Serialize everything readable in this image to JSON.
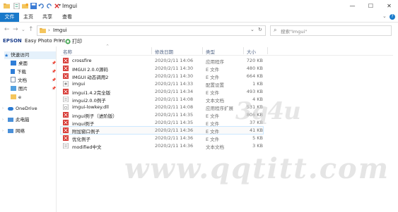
{
  "window": {
    "title": "Imgui",
    "minimize_glyph": "—",
    "maximize_glyph": "☐",
    "close_glyph": "✕",
    "help_glyph": "?"
  },
  "ribbon": {
    "tabs": [
      {
        "label": "文件",
        "active": true
      },
      {
        "label": "主页",
        "active": false
      },
      {
        "label": "共享",
        "active": false
      },
      {
        "label": "查看",
        "active": false
      }
    ]
  },
  "address": {
    "back_glyph": "←",
    "forward_glyph": "→",
    "recent_glyph": "⌄",
    "up_glyph": "↑",
    "separator": "›",
    "path": "Imgui",
    "dropdown_glyph": "⌄",
    "refresh_glyph": "↻",
    "search_placeholder": "搜索\"Imgui\"",
    "search_icon": "⌕"
  },
  "command_bar": {
    "brand": "EPSON",
    "product": "Easy Photo Print",
    "dropdown_glyph": "▾",
    "print_label": "打印"
  },
  "sidebar": {
    "items": [
      {
        "label": "快速访问",
        "icon": "star-icon",
        "pinned": false
      },
      {
        "label": "桌面",
        "icon": "desktop-icon",
        "pinned": true
      },
      {
        "label": "下载",
        "icon": "download-icon",
        "pinned": true
      },
      {
        "label": "文档",
        "icon": "document-icon",
        "pinned": true
      },
      {
        "label": "图片",
        "icon": "picture-icon",
        "pinned": true
      },
      {
        "label": "e",
        "icon": "folder-icon",
        "pinned": false
      },
      {
        "label": "OneDrive",
        "icon": "cloud-icon",
        "pinned": false
      },
      {
        "label": "此电脑",
        "icon": "computer-icon",
        "pinned": false
      },
      {
        "label": "网络",
        "icon": "network-icon",
        "pinned": false
      }
    ]
  },
  "columns": {
    "name": "名称",
    "date": "修改日期",
    "type": "类型",
    "size": "大小",
    "sort_glyph": "^"
  },
  "files": [
    {
      "name": "crossfire",
      "date": "2020/2/11 14:06",
      "type": "应用程序",
      "size": "720 KB",
      "icon": "exe-icon",
      "selected": false
    },
    {
      "name": "IMGUI 2.0.0源码",
      "date": "2020/2/11 14:30",
      "type": "E 文件",
      "size": "480 KB",
      "icon": "e-file-icon",
      "selected": false
    },
    {
      "name": "IMGUI 动态调用2",
      "date": "2020/2/11 14:30",
      "type": "E 文件",
      "size": "664 KB",
      "icon": "e-file-icon",
      "selected": false
    },
    {
      "name": "imgui",
      "date": "2020/2/11 14:33",
      "type": "配置设置",
      "size": "1 KB",
      "icon": "config-icon",
      "selected": false
    },
    {
      "name": "imgui1.4.2完全版",
      "date": "2020/2/11 14:34",
      "type": "E 文件",
      "size": "493 KB",
      "icon": "e-file-icon",
      "selected": false
    },
    {
      "name": "imgui2.0.0例子",
      "date": "2020/2/11 14:08",
      "type": "文本文档",
      "size": "4 KB",
      "icon": "text-file-icon",
      "selected": false
    },
    {
      "name": "imgui-lowkey.dll",
      "date": "2020/2/11 14:08",
      "type": "应用程序扩展",
      "size": "531 KB",
      "icon": "dll-icon",
      "selected": false
    },
    {
      "name": "imgui例子（进阶版）",
      "date": "2020/2/11 14:35",
      "type": "E 文件",
      "size": "806 KB",
      "icon": "e-file-icon",
      "selected": false
    },
    {
      "name": "imgui例子",
      "date": "2020/2/11 14:35",
      "type": "E 文件",
      "size": "37 KB",
      "icon": "e-file-icon",
      "selected": false
    },
    {
      "name": "附加窗口例子",
      "date": "2020/2/11 14:36",
      "type": "E 文件",
      "size": "41 KB",
      "icon": "e-file-icon",
      "selected": true
    },
    {
      "name": "优化例子",
      "date": "2020/2/11 14:36",
      "type": "E 文件",
      "size": "5 KB",
      "icon": "e-file-icon",
      "selected": false
    },
    {
      "name": "modified中文",
      "date": "2020/2/11 14:36",
      "type": "文本文档",
      "size": "3 KB",
      "icon": "text-file-icon",
      "selected": false
    }
  ],
  "watermark": {
    "primary": "3q4u",
    "secondary": "www.qqtitt.com"
  },
  "colors": {
    "accent": "#1979ca",
    "folder": "#f4c55c",
    "e_file": "#d73a35",
    "header_text": "#4d6082"
  }
}
